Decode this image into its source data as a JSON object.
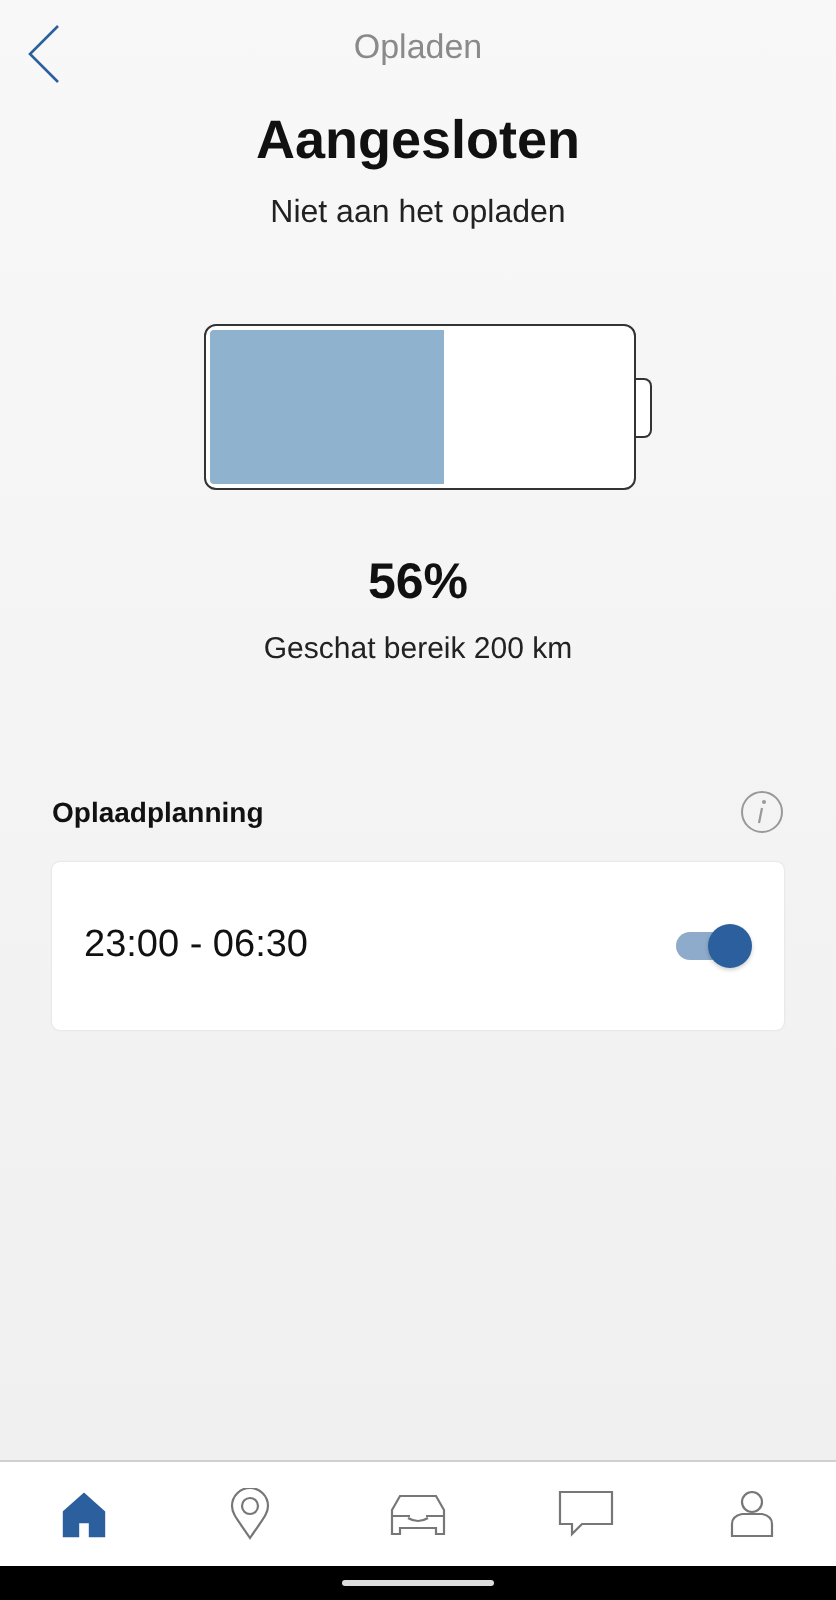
{
  "header": {
    "title": "Opladen"
  },
  "status": {
    "title": "Aangesloten",
    "subtitle": "Niet aan het opladen"
  },
  "battery": {
    "level": 0.56,
    "percent": "56%",
    "range": "Geschat bereik 200 km"
  },
  "schedule": {
    "heading": "Oplaadplanning",
    "time": "23:00 - 06:30",
    "on": true
  },
  "nav": [
    {
      "kind": "home",
      "selected": true
    },
    {
      "kind": "location",
      "selected": false
    },
    {
      "kind": "car",
      "selected": false
    },
    {
      "kind": "chat",
      "selected": false
    },
    {
      "kind": "profile",
      "selected": false
    }
  ]
}
